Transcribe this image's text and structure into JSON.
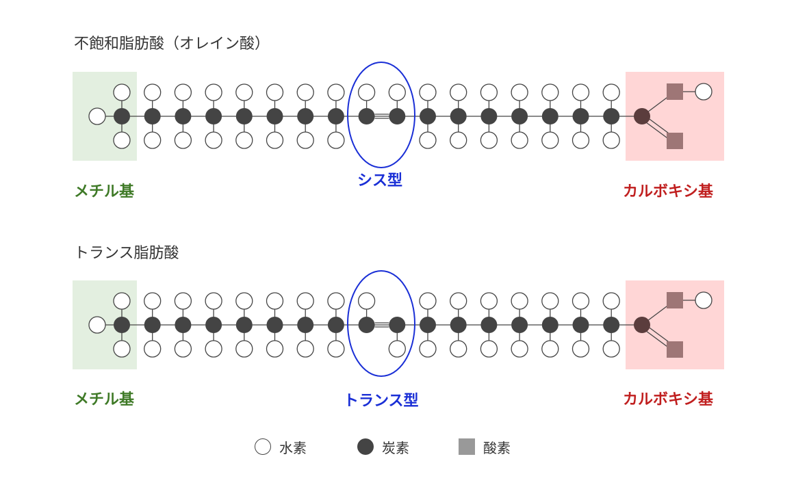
{
  "panels": [
    {
      "title": "不飽和脂肪酸（オレイン酸）",
      "left_label": "メチル基",
      "right_label": "カルボキシ基",
      "config_label": "シス型",
      "configuration": "cis"
    },
    {
      "title": "トランス脂肪酸",
      "left_label": "メチル基",
      "right_label": "カルボキシ基",
      "config_label": "トランス型",
      "configuration": "trans"
    }
  ],
  "legend": {
    "hydrogen": "水素",
    "carbon": "炭素",
    "oxygen": "酸素"
  },
  "colors": {
    "carbon": "#444444",
    "hydrogen_fill": "#ffffff",
    "oxygen": "#9e7676",
    "methyl_bg": "#e3efe0",
    "carboxyl_bg": "#ffd6d6",
    "highlight_ellipse": "#1a2fd6",
    "methyl_label": "#3f7a27",
    "carboxyl_label": "#c01f1f"
  }
}
